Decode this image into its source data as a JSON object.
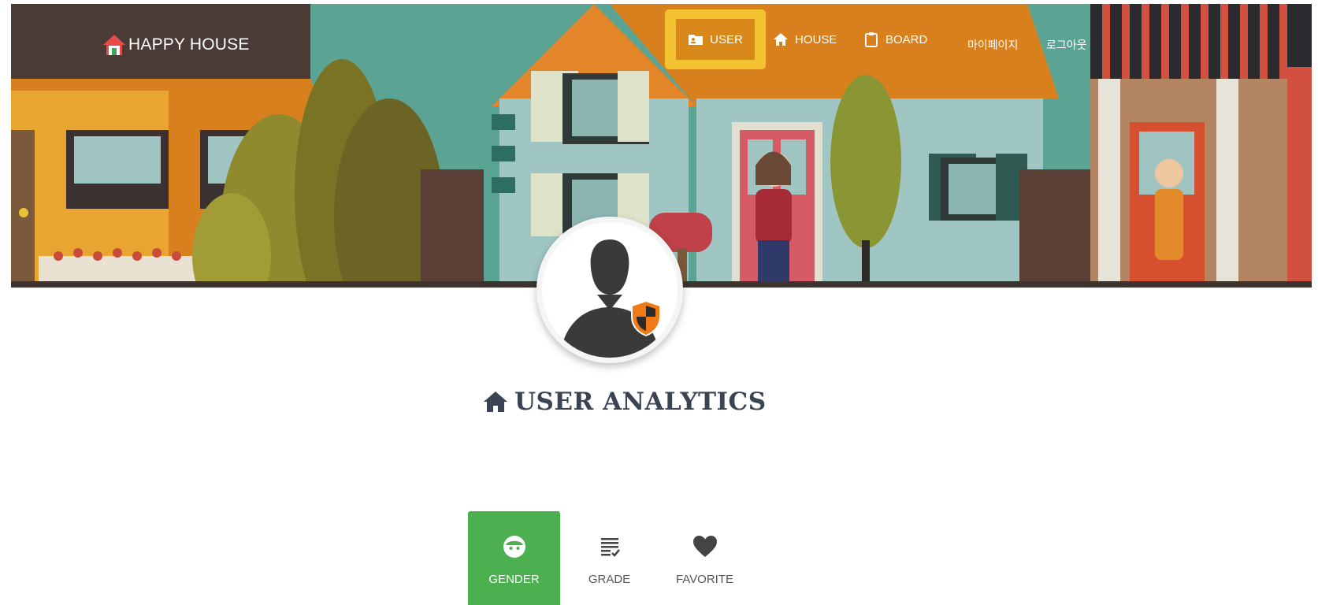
{
  "brand": {
    "name": "HAPPY HOUSE",
    "icon": "house-logo-icon"
  },
  "nav": {
    "user": {
      "label": "USER",
      "icon": "user-card-icon"
    },
    "house": {
      "label": "HOUSE",
      "icon": "home-icon"
    },
    "board": {
      "label": "BOARD",
      "icon": "clipboard-icon"
    },
    "mypage": {
      "label": "마이페이지"
    },
    "logout": {
      "label": "로그아웃"
    }
  },
  "avatar": {
    "icon": "user-shield-icon"
  },
  "page": {
    "title": "USER ANALYTICS",
    "title_icon": "home-icon"
  },
  "tabs": [
    {
      "label": "GENDER",
      "icon": "face-icon",
      "active": true
    },
    {
      "label": "GRADE",
      "icon": "list-check-icon",
      "active": false
    },
    {
      "label": "FAVORITE",
      "icon": "heart-icon",
      "active": false
    }
  ],
  "colors": {
    "active_tab": "#4caf50",
    "nav_highlight": "#f2c230",
    "title_text": "#3a4452",
    "shield": "#f07a16"
  }
}
